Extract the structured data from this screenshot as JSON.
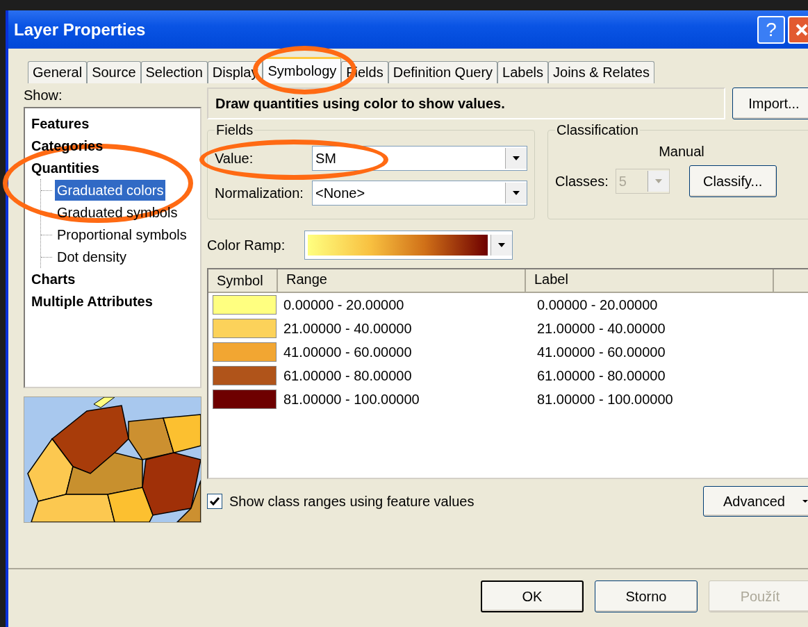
{
  "window": {
    "title": "Layer Properties",
    "help_button": "?"
  },
  "tabs": [
    {
      "label": "General",
      "selected": false,
      "circled": false
    },
    {
      "label": "Source",
      "selected": false,
      "circled": false
    },
    {
      "label": "Selection",
      "selected": false,
      "circled": false
    },
    {
      "label": "Display",
      "selected": false,
      "circled": false
    },
    {
      "label": "Symbology",
      "selected": true,
      "circled": true
    },
    {
      "label": "Fields",
      "selected": false,
      "circled": false
    },
    {
      "label": "Definition Query",
      "selected": false,
      "circled": false
    },
    {
      "label": "Labels",
      "selected": false,
      "circled": false
    },
    {
      "label": "Joins & Relates",
      "selected": false,
      "circled": false
    }
  ],
  "show": {
    "label": "Show:",
    "tree": [
      {
        "label": "Features",
        "selected": false,
        "circled": false
      },
      {
        "label": "Categories",
        "selected": false,
        "circled": false
      },
      {
        "label": "Quantities",
        "selected": false,
        "circled": false,
        "children": [
          {
            "label": "Graduated colors",
            "selected": true,
            "circled": true
          },
          {
            "label": "Graduated symbols",
            "selected": false,
            "circled": false
          },
          {
            "label": "Proportional symbols",
            "selected": false,
            "circled": false
          },
          {
            "label": "Dot density",
            "selected": false,
            "circled": false
          }
        ]
      },
      {
        "label": "Charts",
        "selected": false,
        "circled": false
      },
      {
        "label": "Multiple Attributes",
        "selected": false,
        "circled": false
      }
    ]
  },
  "description": "Draw quantities using color to show values.",
  "import_button": "Import...",
  "fields": {
    "title": "Fields",
    "value_label": "Value:",
    "value": "SM",
    "value_circled": true,
    "normalization_label": "Normalization:",
    "normalization": "<None>"
  },
  "classification": {
    "title": "Classification",
    "method": "Manual",
    "classes_label": "Classes:",
    "classes": "5",
    "classes_disabled": true,
    "classify_button": "Classify..."
  },
  "color_ramp": {
    "label": "Color Ramp:"
  },
  "table": {
    "columns": [
      "Symbol",
      "Range",
      "Label"
    ],
    "rows": [
      {
        "color": "#ffff80",
        "range": "0.00000 - 20.00000",
        "label": "0.00000 - 20.00000"
      },
      {
        "color": "#fcd25a",
        "range": "21.00000 - 40.00000",
        "label": "21.00000 - 40.00000"
      },
      {
        "color": "#f2a632",
        "range": "41.00000 - 60.00000",
        "label": "41.00000 - 60.00000"
      },
      {
        "color": "#b0541a",
        "range": "61.00000 - 80.00000",
        "label": "61.00000 - 80.00000"
      },
      {
        "color": "#6e0000",
        "range": "81.00000 - 100.00000",
        "label": "81.00000 - 100.00000"
      }
    ]
  },
  "show_class_ranges": {
    "label": "Show class ranges using feature values",
    "checked": true
  },
  "advanced_button": "Advanced",
  "buttons": [
    {
      "label": "OK",
      "disabled": false,
      "default": true
    },
    {
      "label": "Storno",
      "disabled": false,
      "default": false
    },
    {
      "label": "Použít",
      "disabled": true,
      "default": false
    }
  ]
}
